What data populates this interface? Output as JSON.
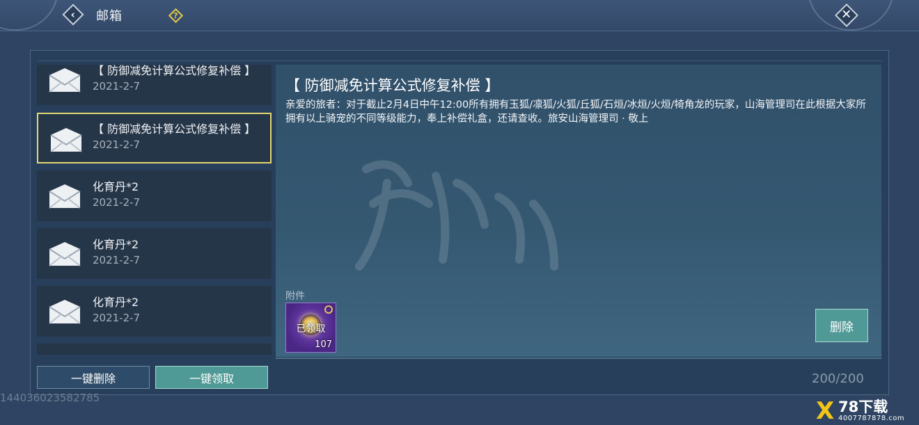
{
  "header": {
    "title": "邮箱",
    "back_icon": "chevron-left-icon",
    "help_icon": "question-diamond-icon",
    "close_icon": "close-x-icon"
  },
  "mail_list": [
    {
      "title": "【 防御减免计算公式修复补偿 】",
      "date": "2021-2-7"
    },
    {
      "title": "【 防御减免计算公式修复补偿 】",
      "date": "2021-2-7"
    },
    {
      "title": "化育丹*2",
      "date": "2021-2-7"
    },
    {
      "title": "化育丹*2",
      "date": "2021-2-7"
    },
    {
      "title": "化育丹*2",
      "date": "2021-2-7"
    }
  ],
  "detail": {
    "title": "【 防御减免计算公式修复补偿 】",
    "body": "亲爱的旅者：对于截止2月4日中午12:00所有拥有玉狐/凛狐/火狐/丘狐/石烜/冰烜/火烜/犄角龙的玩家，山海管理司在此根据大家所拥有以上骑宠的不同等级能力，奉上补偿礼盒，还请查收。旅安山海管理司 · 敬上",
    "attachment_label": "附件",
    "attachment": {
      "status": "已领取",
      "count": "107"
    },
    "delete_label": "删除"
  },
  "footer": {
    "delete_all_label": "一键删除",
    "claim_all_label": "一键领取",
    "counter": "200/200",
    "uid": "144036023582785"
  },
  "watermark_logo": {
    "name": "78下载",
    "sub": "4007787878.com"
  },
  "colors": {
    "accent_teal": "#4f9a96",
    "selected_border": "#e5d770",
    "help_gold": "#e3c94a",
    "item_purple": "#5b2f99"
  }
}
